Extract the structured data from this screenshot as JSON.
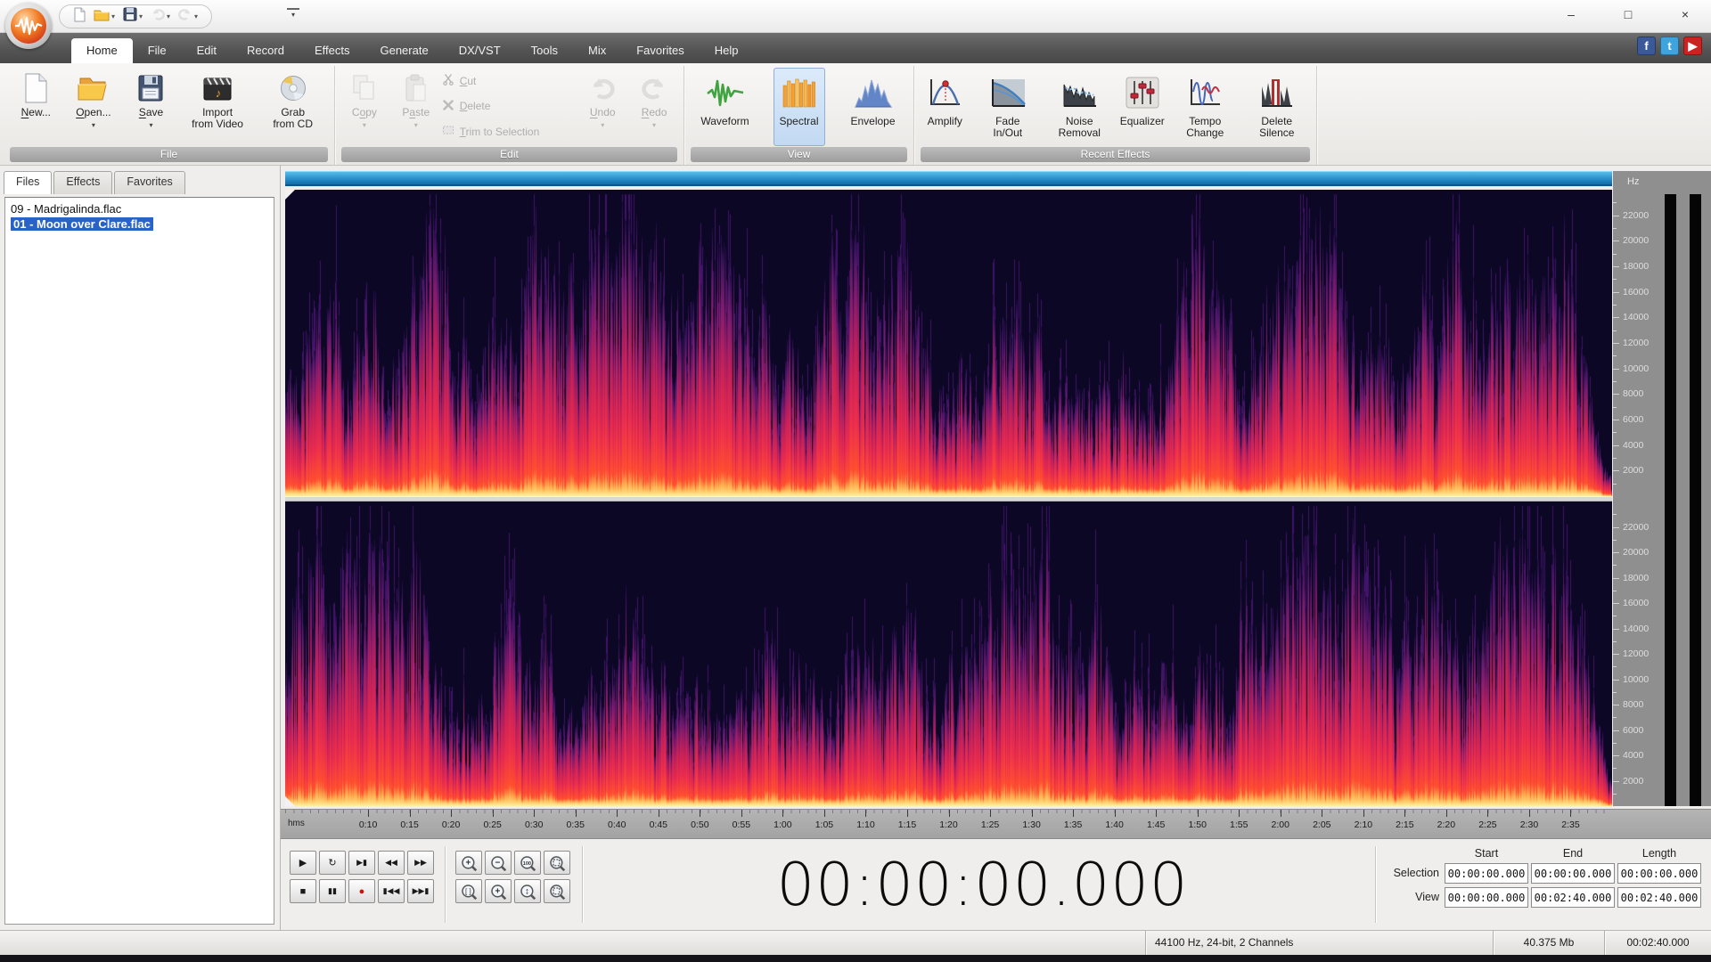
{
  "window": {
    "controls": [
      {
        "name": "minimize",
        "glyph": "–"
      },
      {
        "name": "maximize",
        "glyph": "□"
      },
      {
        "name": "close",
        "glyph": "×"
      }
    ]
  },
  "quick_access": {
    "buttons": [
      {
        "name": "new-document",
        "icon": "page-s",
        "arrow": false,
        "disabled": false
      },
      {
        "name": "open",
        "icon": "folder-s",
        "arrow": true,
        "disabled": false
      },
      {
        "name": "save",
        "icon": "floppy-s",
        "arrow": true,
        "disabled": false
      },
      {
        "name": "undo",
        "icon": "undo-s",
        "arrow": true,
        "disabled": true
      },
      {
        "name": "redo",
        "icon": "redo-s",
        "arrow": true,
        "disabled": true
      }
    ]
  },
  "tabs": {
    "items": [
      "Home",
      "File",
      "Edit",
      "Record",
      "Effects",
      "Generate",
      "DX/VST",
      "Tools",
      "Mix",
      "Favorites",
      "Help"
    ],
    "active": "Home"
  },
  "social": [
    {
      "name": "facebook",
      "label": "f",
      "color": "#3b5998"
    },
    {
      "name": "twitter",
      "label": "t",
      "color": "#3fa4dd"
    },
    {
      "name": "youtube",
      "label": "▶",
      "color": "#cc2222"
    }
  ],
  "ribbon": {
    "groups": [
      {
        "caption": "File",
        "buttons": [
          {
            "name": "new",
            "label": "New...",
            "u": 0,
            "icon": "page"
          },
          {
            "name": "open",
            "label": "Open...",
            "u": 0,
            "icon": "folder",
            "arrow": true
          },
          {
            "name": "save",
            "label": "Save",
            "u": 0,
            "icon": "floppy",
            "arrow": true
          },
          {
            "name": "import-from-video",
            "lines": [
              "Import",
              "from Video"
            ],
            "icon": "video"
          },
          {
            "name": "grab-from-cd",
            "lines": [
              "Grab",
              "from CD"
            ],
            "icon": "cd"
          }
        ]
      },
      {
        "caption": "Edit",
        "buttons": [
          {
            "name": "copy",
            "label": "Copy",
            "u": 1,
            "icon": "copy",
            "arrow": true,
            "disabled": true
          },
          {
            "name": "paste",
            "label": "Paste",
            "u": 1,
            "icon": "paste",
            "arrow": true,
            "disabled": true
          }
        ],
        "small": [
          {
            "name": "cut",
            "label": "Cut",
            "u": 0,
            "icon": "cut",
            "disabled": true
          },
          {
            "name": "delete",
            "label": "Delete",
            "u": 0,
            "icon": "delete",
            "disabled": true
          },
          {
            "name": "trim-to-selection",
            "label": "Trim to Selection",
            "u": 0,
            "icon": "trim",
            "disabled": true
          }
        ],
        "buttons2": [
          {
            "name": "undo",
            "label": "Undo",
            "u": 0,
            "icon": "undo",
            "arrow": true,
            "disabled": true
          },
          {
            "name": "redo",
            "label": "Redo",
            "u": 0,
            "icon": "redo",
            "arrow": true,
            "disabled": true
          }
        ]
      },
      {
        "caption": "View",
        "view": true,
        "buttons": [
          {
            "name": "waveform",
            "label": "Waveform",
            "icon": "waveform"
          },
          {
            "name": "spectral",
            "label": "Spectral",
            "icon": "spectral",
            "active": true
          },
          {
            "name": "envelope",
            "label": "Envelope",
            "icon": "envelope"
          }
        ]
      },
      {
        "caption": "Recent Effects",
        "view": true,
        "buttons": [
          {
            "name": "amplify",
            "label": "Amplify",
            "icon": "amplify"
          },
          {
            "name": "fade-in-out",
            "lines": [
              "Fade",
              "In/Out"
            ],
            "icon": "fade"
          },
          {
            "name": "noise-removal",
            "lines": [
              "Noise",
              "Removal"
            ],
            "icon": "noise"
          },
          {
            "name": "equalizer",
            "label": "Equalizer",
            "icon": "equalizer"
          },
          {
            "name": "tempo-change",
            "lines": [
              "Tempo",
              "Change"
            ],
            "icon": "tempo"
          },
          {
            "name": "delete-silence",
            "lines": [
              "Delete",
              "Silence"
            ],
            "icon": "delsil"
          }
        ]
      }
    ]
  },
  "panel": {
    "tabs": [
      "Files",
      "Effects",
      "Favorites"
    ],
    "active": "Files",
    "files": [
      {
        "name": "09 - Madrigalinda.flac",
        "selected": false
      },
      {
        "name": "01 - Moon over Clare.flac",
        "selected": true
      }
    ]
  },
  "spectrogram": {
    "channels": 2,
    "background": "#0b0724",
    "palette": [
      "#ffe690",
      "#ffb050",
      "#ff4f2e",
      "#ea2c4e",
      "#c22058",
      "#7c1a6e",
      "#431463",
      "#1d0a3e"
    ],
    "overview_color": "#1e82c0"
  },
  "freq_axis": {
    "unit": "Hz",
    "max_hz": 24000,
    "labels": [
      22000,
      20000,
      18000,
      16000,
      14000,
      12000,
      10000,
      8000,
      6000,
      4000,
      2000
    ]
  },
  "ruler": {
    "unit": "hms",
    "duration_s": 160,
    "first_label_s": 10,
    "step_s": 5,
    "labels": [
      "0:10",
      "0:15",
      "0:20",
      "0:25",
      "0:30",
      "0:35",
      "0:40",
      "0:45",
      "0:50",
      "0:55",
      "1:00",
      "1:05",
      "1:10",
      "1:15",
      "1:20",
      "1:25",
      "1:30",
      "1:35",
      "1:40",
      "1:45",
      "1:50",
      "1:55",
      "2:00",
      "2:05",
      "2:10",
      "2:15",
      "2:20",
      "2:25",
      "2:30",
      "2:35"
    ]
  },
  "transport": {
    "record_color": "#cc1111",
    "rows": [
      [
        {
          "name": "play",
          "glyph": "▶"
        },
        {
          "name": "loop",
          "glyph": "↻"
        },
        {
          "name": "play-to-end",
          "glyph": "▶▮"
        },
        {
          "name": "rewind",
          "glyph": "◀◀"
        },
        {
          "name": "fast-forward",
          "glyph": "▶▶"
        }
      ],
      [
        {
          "name": "stop",
          "glyph": "■"
        },
        {
          "name": "pause",
          "glyph": "▮▮"
        },
        {
          "name": "record",
          "glyph": "●"
        },
        {
          "name": "go-to-start",
          "glyph": "▮◀◀"
        },
        {
          "name": "go-to-end",
          "glyph": "▶▶▮"
        }
      ]
    ]
  },
  "zoom_controls": {
    "rows": [
      [
        {
          "name": "zoom-in",
          "glyph": "+"
        },
        {
          "name": "zoom-out",
          "glyph": "−"
        },
        {
          "name": "zoom-100",
          "glyph": "100"
        },
        {
          "name": "zoom-to-selection",
          "glyph": "sel"
        }
      ],
      [
        {
          "name": "zoom-restore",
          "glyph": "[]"
        },
        {
          "name": "vertical-zoom-in",
          "glyph": "+"
        },
        {
          "name": "vertical-zoom-fit",
          "glyph": "↕"
        },
        {
          "name": "vertical-zoom-selection",
          "glyph": "sel"
        }
      ]
    ]
  },
  "time_display": {
    "value": "00:00:00.000"
  },
  "selection_panel": {
    "headers": [
      "Start",
      "End",
      "Length"
    ],
    "rows": [
      {
        "label": "Selection",
        "values": [
          "00:00:00.000",
          "00:00:00.000",
          "00:00:00.000"
        ]
      },
      {
        "label": "View",
        "values": [
          "00:00:00.000",
          "00:02:40.000",
          "00:02:40.000"
        ]
      }
    ]
  },
  "status_bar": {
    "format": "44100 Hz, 24-bit, 2 Channels",
    "file_size": "40.375 Mb",
    "length": "00:02:40.000"
  }
}
